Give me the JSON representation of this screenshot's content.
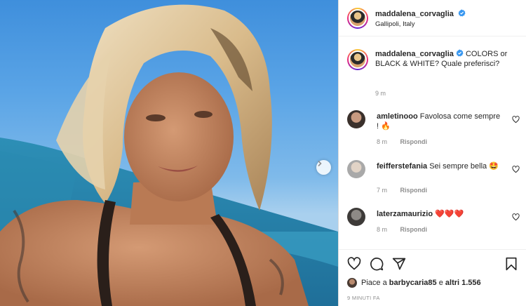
{
  "post": {
    "username": "maddalena_corvaglia",
    "location": "Gallipoli, Italy",
    "caption_text": "COLORS or BLACK & WHITE? Quale preferisci?",
    "caption_time": "9 m",
    "image_icon": "selfie-photo"
  },
  "comments": [
    {
      "username": "amletinooo",
      "text": "Favolosa come sempre ! 🔥",
      "time": "8 m",
      "reply_label": "Rispondi"
    },
    {
      "username": "feifferstefania",
      "text": "Sei sempre bella 🤩",
      "time": "7 m",
      "reply_label": "Rispondi"
    },
    {
      "username": "laterzamaurizio",
      "text": "❤️❤️❤️",
      "time": "8 m",
      "reply_label": "Rispondi"
    }
  ],
  "likes": {
    "prefix": "Piace a",
    "liker": "barbycaria85",
    "connector": "e",
    "others": "altri 1.556"
  },
  "posted_ago": "9 MINUTI FA",
  "colors": {
    "verified_blue": "#3897f0",
    "muted_text": "#8e8e8e",
    "border": "#dbdbdb"
  },
  "icons": [
    "verified-badge-icon",
    "heart-icon",
    "comment-icon",
    "share-icon",
    "bookmark-icon",
    "chevron-right-icon"
  ]
}
